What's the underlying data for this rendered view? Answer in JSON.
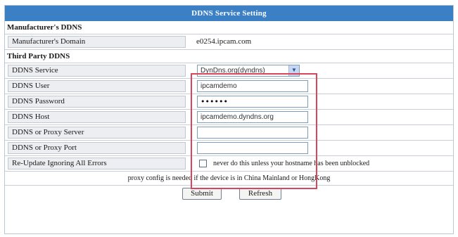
{
  "panel": {
    "title": "DDNS Service Setting"
  },
  "sections": {
    "manufacturer": "Manufacturer's DDNS",
    "third_party": "Third Party DDNS"
  },
  "fields": {
    "domain": {
      "label": "Manufacturer's Domain",
      "value": "e0254.ipcam.com"
    },
    "service": {
      "label": "DDNS Service",
      "selected": "DynDns.org(dyndns)"
    },
    "user": {
      "label": "DDNS User",
      "value": "ipcamdemo"
    },
    "password": {
      "label": "DDNS Password",
      "value": "••••••"
    },
    "host": {
      "label": "DDNS Host",
      "value": "ipcamdemo.dyndns.org"
    },
    "proxy_server": {
      "label": "DDNS or Proxy Server",
      "value": ""
    },
    "proxy_port": {
      "label": "DDNS or Proxy Port",
      "value": ""
    },
    "reupdate": {
      "label": "Re-Update Ignoring All Errors",
      "checkbox_text": "never do this unless your hostname has been unblocked",
      "checked": false
    }
  },
  "note": "proxy config is needed if the device is in China Mainland or HongKong",
  "buttons": {
    "submit": "Submit",
    "refresh": "Refresh"
  },
  "colors": {
    "title_bar": "#3b7fc4",
    "highlight": "#d9455c",
    "label_bg": "#eceef1"
  },
  "icons": {
    "select_arrow": "chevron-down-icon"
  }
}
